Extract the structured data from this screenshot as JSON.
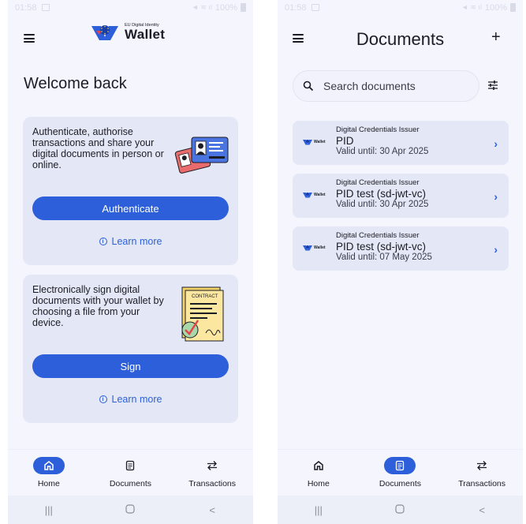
{
  "status": {
    "time": "01:58",
    "battery": "100%"
  },
  "home": {
    "logo_small": "EU Digital Identity",
    "logo_big": "Wallet",
    "welcome": "Welcome back",
    "auth_card": {
      "text": "Authenticate, authorise transactions and share your digital documents in person or online.",
      "button": "Authenticate",
      "learn_more": "Learn more"
    },
    "sign_card": {
      "text": "Electronically sign digital documents with your wallet by choosing a file from your device.",
      "button": "Sign",
      "learn_more": "Learn more",
      "contract_label": "CONTRACT"
    }
  },
  "documents": {
    "title": "Documents",
    "search_placeholder": "Search documents",
    "logo_text": "Wallet",
    "items": [
      {
        "issuer": "Digital Credentials Issuer",
        "name": "PID",
        "valid": "Valid until: 30 Apr 2025"
      },
      {
        "issuer": "Digital Credentials Issuer",
        "name": "PID test (sd-jwt-vc)",
        "valid": "Valid until: 30 Apr 2025"
      },
      {
        "issuer": "Digital Credentials Issuer",
        "name": "PID test (sd-jwt-vc)",
        "valid": "Valid until: 07 May 2025"
      }
    ]
  },
  "nav": {
    "home": "Home",
    "documents": "Documents",
    "transactions": "Transactions"
  },
  "colors": {
    "accent": "#2c5fd9",
    "card_bg": "#e4e8f6",
    "screen_bg": "#f4f5fd"
  }
}
